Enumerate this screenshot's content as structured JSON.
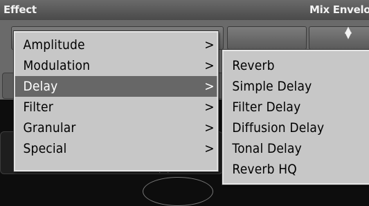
{
  "header": {
    "effect_label": "Effect",
    "mix_label": "Mix Envelo"
  },
  "effect_menu": {
    "items": [
      {
        "label": "Amplitude",
        "arrow": ">"
      },
      {
        "label": "Modulation",
        "arrow": ">"
      },
      {
        "label": "Delay",
        "arrow": ">"
      },
      {
        "label": "Filter",
        "arrow": ">"
      },
      {
        "label": "Granular",
        "arrow": ">"
      },
      {
        "label": "Special",
        "arrow": ">"
      }
    ],
    "active_item": "Delay"
  },
  "delay_submenu": {
    "items": [
      {
        "label": "Reverb"
      },
      {
        "label": "Simple Delay"
      },
      {
        "label": "Filter Delay"
      },
      {
        "label": "Diffusion Delay"
      },
      {
        "label": "Tonal Delay"
      },
      {
        "label": "Reverb HQ"
      }
    ]
  },
  "colors": {
    "menu_background": "#c7c7c7",
    "active_item": "#676767",
    "panel_background": "#6a6a6a"
  },
  "icons": {
    "mix_selector": "up-down-arrows-icon"
  }
}
